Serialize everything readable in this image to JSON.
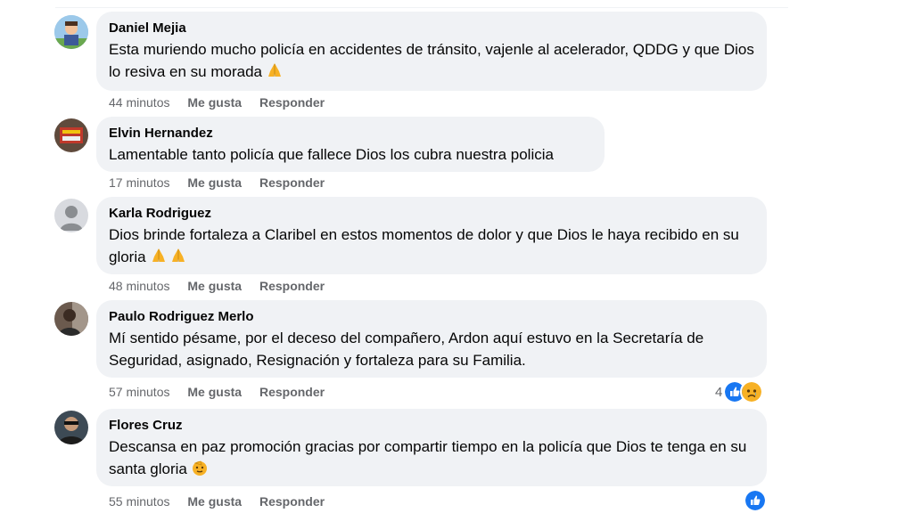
{
  "comments": [
    {
      "author": "Daniel Mejia",
      "text": "Esta muriendo mucho policía en accidentes de tránsito, vajenle al acelerador, QDDG y que Dios lo resiva en su morada",
      "time": "44 minutos",
      "like": "Me gusta",
      "reply": "Responder"
    },
    {
      "author": "Elvin Hernandez",
      "text": "Lamentable tanto policía que fallece Dios los cubra nuestra policia",
      "time": "17 minutos",
      "like": "Me gusta",
      "reply": "Responder"
    },
    {
      "author": "Karla Rodriguez",
      "text": "Dios brinde fortaleza a Claribel en estos momentos de dolor y que Dios le haya recibido en su gloria",
      "time": "48 minutos",
      "like": "Me gusta",
      "reply": "Responder"
    },
    {
      "author": "Paulo Rodriguez Merlo",
      "text": "Mí sentido pésame, por el deceso del compañero, Ardon aquí estuvo en la Secretaría de Seguridad, asignado, Resignación y fortaleza para su Familia.",
      "time": "57 minutos",
      "like": "Me gusta",
      "reply": "Responder",
      "reaction_count": "4"
    },
    {
      "author": "Flores Cruz",
      "text": "Descansa en paz promoción gracias por compartir tiempo en la policía que Dios te tenga en su santa gloria",
      "time": "55 minutos",
      "like": "Me gusta",
      "reply": "Responder"
    }
  ],
  "colors": {
    "bubble": "#f0f2f5",
    "meta": "#65676b",
    "like_blue": "#1877f2",
    "sad_yellow": "#f7b125"
  },
  "icons": {
    "pray": "folded-hands-emoji",
    "like": "like-reaction-icon",
    "sad": "sad-reaction-icon",
    "salute": "saluting-face-emoji"
  }
}
